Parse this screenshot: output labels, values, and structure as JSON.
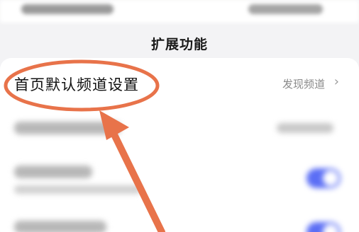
{
  "header": {
    "section_title": "扩展功能"
  },
  "settings": {
    "homepage_default_channel": {
      "label": "首页默认频道设置",
      "value": "发现频道",
      "chevron": "›"
    }
  },
  "colors": {
    "annotation": "#e8734a",
    "toggle_on": "#5b6ef5",
    "text_primary": "#111111",
    "text_secondary": "#8a8a8a"
  },
  "icons": {
    "chevron": "chevron-right-icon",
    "arrow": "annotation-arrow-icon"
  }
}
